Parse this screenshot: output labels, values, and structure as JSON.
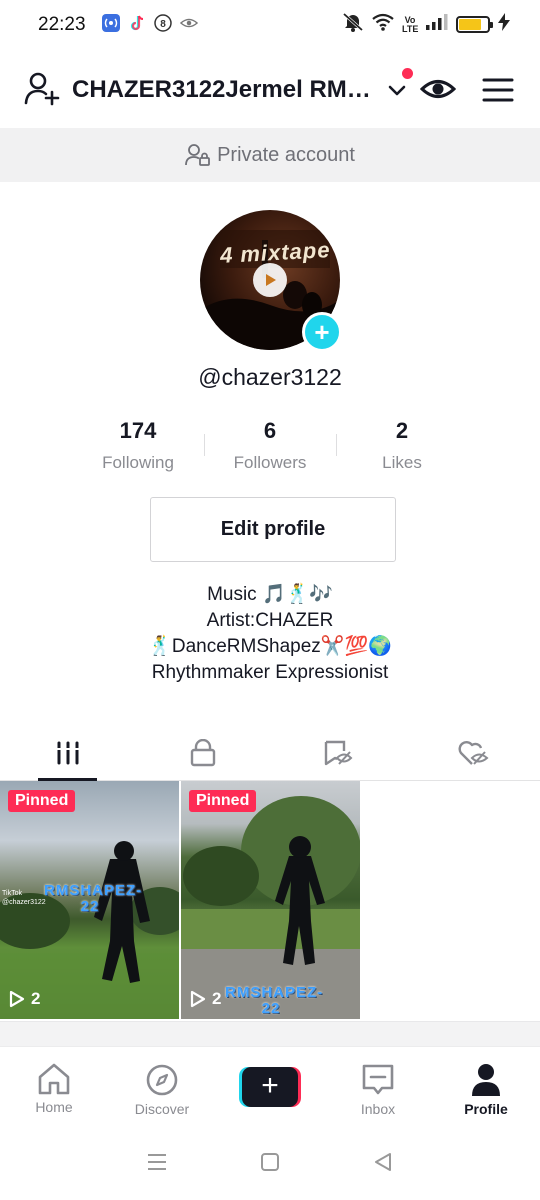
{
  "status_bar": {
    "time": "22:23",
    "left_icons": [
      "hotspot-icon",
      "tiktok-icon",
      "b-icon",
      "eye-scan-icon"
    ],
    "right_icons": [
      "mute-icon",
      "wifi-icon",
      "volte-icon",
      "signal-icon",
      "battery-icon",
      "charging-icon"
    ],
    "battery_level": 0.8,
    "volte_label": "Vo LTE"
  },
  "header": {
    "username": "CHAZER3122Jermel RMS…",
    "has_notification": true
  },
  "private_banner": {
    "text": "Private account"
  },
  "profile": {
    "avatar_text": "4 mixtape",
    "handle": "@chazer3122",
    "stats": [
      {
        "value": "174",
        "label": "Following"
      },
      {
        "value": "6",
        "label": "Followers"
      },
      {
        "value": "2",
        "label": "Likes"
      }
    ],
    "edit_button": "Edit profile",
    "bio_lines": [
      "Music 🎵🕺🎶",
      "Artist:CHAZER",
      "🕺DanceRMShapez✂️💯🌍",
      "Rhythmmaker Expressionist"
    ]
  },
  "tabs": [
    {
      "icon": "grid-icon",
      "active": true
    },
    {
      "icon": "lock-icon",
      "active": false
    },
    {
      "icon": "bookmark-icon",
      "active": false
    },
    {
      "icon": "liked-hidden-icon",
      "active": false
    }
  ],
  "videos": [
    {
      "badge": "Pinned",
      "views": "2",
      "overlay": "RMSHAPEZ-22",
      "watermark": "TikTok @chazer3122"
    },
    {
      "badge": "Pinned",
      "views": "2",
      "overlay": "RMSHAPEZ-22"
    }
  ],
  "bottom_nav": [
    {
      "label": "Home",
      "icon": "home-icon",
      "active": false
    },
    {
      "label": "Discover",
      "icon": "compass-icon",
      "active": false
    },
    {
      "label": "",
      "icon": "create-icon",
      "active": false
    },
    {
      "label": "Inbox",
      "icon": "inbox-icon",
      "active": false
    },
    {
      "label": "Profile",
      "icon": "profile-icon",
      "active": true
    }
  ],
  "colors": {
    "accent": "#fe2c55",
    "cyan": "#20d5ec",
    "text_primary": "#161823",
    "text_secondary": "#8a8b91"
  }
}
